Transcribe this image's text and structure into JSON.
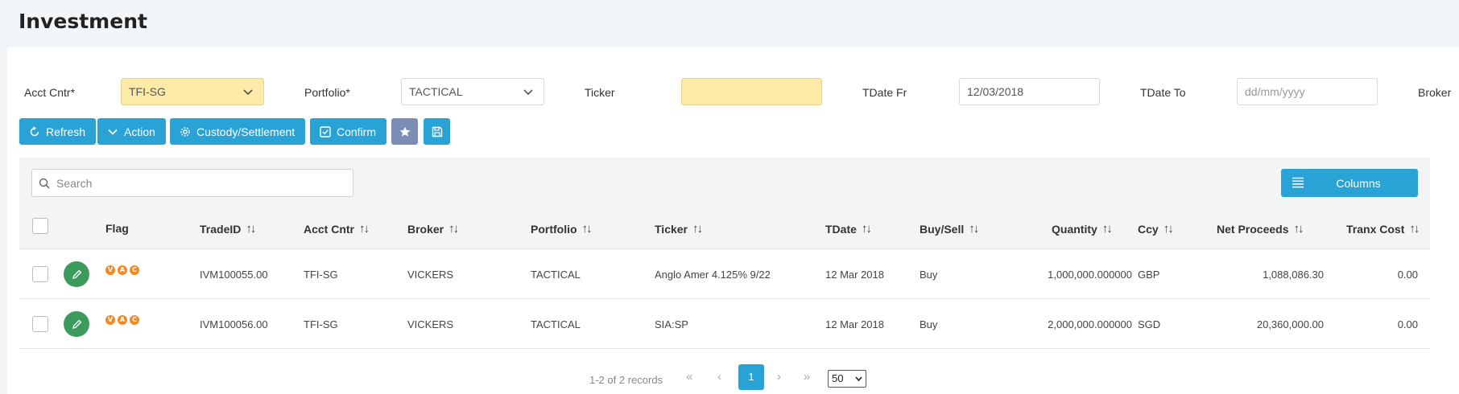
{
  "page": {
    "title": "Investment"
  },
  "filters": {
    "acct_cntr": {
      "label": "Acct Cntr*",
      "value": "TFI-SG"
    },
    "portfolio": {
      "label": "Portfolio*",
      "value": "TACTICAL"
    },
    "ticker": {
      "label": "Ticker",
      "value": ""
    },
    "tdate_fr": {
      "label": "TDate Fr",
      "value": "12/03/2018"
    },
    "tdate_to": {
      "label": "TDate To",
      "placeholder": "dd/mm/yyyy"
    },
    "broker": {
      "label": "Broker"
    }
  },
  "toolbar": {
    "refresh": "Refresh",
    "action": "Action",
    "custody": "Custody/Settlement",
    "confirm": "Confirm"
  },
  "grid": {
    "search_placeholder": "Search",
    "columns_label": "Columns",
    "headers": {
      "flag": "Flag",
      "trade_id": "TradeID",
      "acct_cntr": "Acct Cntr",
      "broker": "Broker",
      "portfolio": "Portfolio",
      "ticker": "Ticker",
      "tdate": "TDate",
      "buy_sell": "Buy/Sell",
      "quantity": "Quantity",
      "ccy": "Ccy",
      "net_proceeds": "Net Proceeds",
      "tranx_cost": "Tranx Cost"
    },
    "flag_letters": [
      "V",
      "A",
      "C"
    ],
    "rows": [
      {
        "trade_id": "IVM100055.00",
        "acct_cntr": "TFI-SG",
        "broker": "VICKERS",
        "portfolio": "TACTICAL",
        "ticker": "Anglo Amer 4.125% 9/22",
        "tdate": "12 Mar 2018",
        "buy_sell": "Buy",
        "quantity": "1,000,000.000000",
        "ccy": "GBP",
        "net_proceeds": "1,088,086.30",
        "tranx_cost": "0.00"
      },
      {
        "trade_id": "IVM100056.00",
        "acct_cntr": "TFI-SG",
        "broker": "VICKERS",
        "portfolio": "TACTICAL",
        "ticker": "SIA:SP",
        "tdate": "12 Mar 2018",
        "buy_sell": "Buy",
        "quantity": "2,000,000.000000",
        "ccy": "SGD",
        "net_proceeds": "20,360,000.00",
        "tranx_cost": "0.00"
      }
    ]
  },
  "pagination": {
    "records_text": "1-2 of 2 records",
    "first": "«",
    "prev": "‹",
    "current_page": "1",
    "next": "›",
    "last": "»",
    "page_size": "50"
  },
  "colors": {
    "primary": "#29a3d6",
    "grey_button": "#7c8db5",
    "edit_green": "#3a9b5c",
    "flag_orange": "#f08a24",
    "required_yellow": "#fdeaa7"
  }
}
